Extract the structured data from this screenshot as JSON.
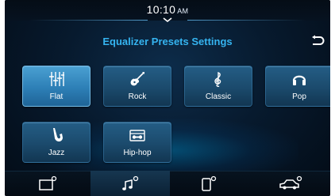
{
  "status": {
    "time": "10:10",
    "ampm": "AM"
  },
  "header": {
    "title": "Equalizer Presets Settings",
    "back_icon": "back-arrow-icon"
  },
  "presets": [
    {
      "label": "Flat",
      "icon": "sliders-icon",
      "selected": true
    },
    {
      "label": "Rock",
      "icon": "guitar-icon",
      "selected": false
    },
    {
      "label": "Classic",
      "icon": "treble-clef-icon",
      "selected": false
    },
    {
      "label": "Pop",
      "icon": "headphones-icon",
      "selected": false
    },
    {
      "label": "Jazz",
      "icon": "saxophone-icon",
      "selected": false
    },
    {
      "label": "Hip-hop",
      "icon": "boombox-icon",
      "selected": false
    }
  ],
  "bottom_nav": [
    {
      "name": "display-settings",
      "icon": "display-gear-icon",
      "active": false
    },
    {
      "name": "sound-settings",
      "icon": "music-gear-icon",
      "active": true
    },
    {
      "name": "phone-settings",
      "icon": "phone-gear-icon",
      "active": false
    },
    {
      "name": "vehicle-settings",
      "icon": "car-gear-icon",
      "active": false
    }
  ],
  "colors": {
    "accent": "#35b4f0",
    "tile": "#1b4a6c",
    "tile_selected": "#2d7fb6"
  }
}
